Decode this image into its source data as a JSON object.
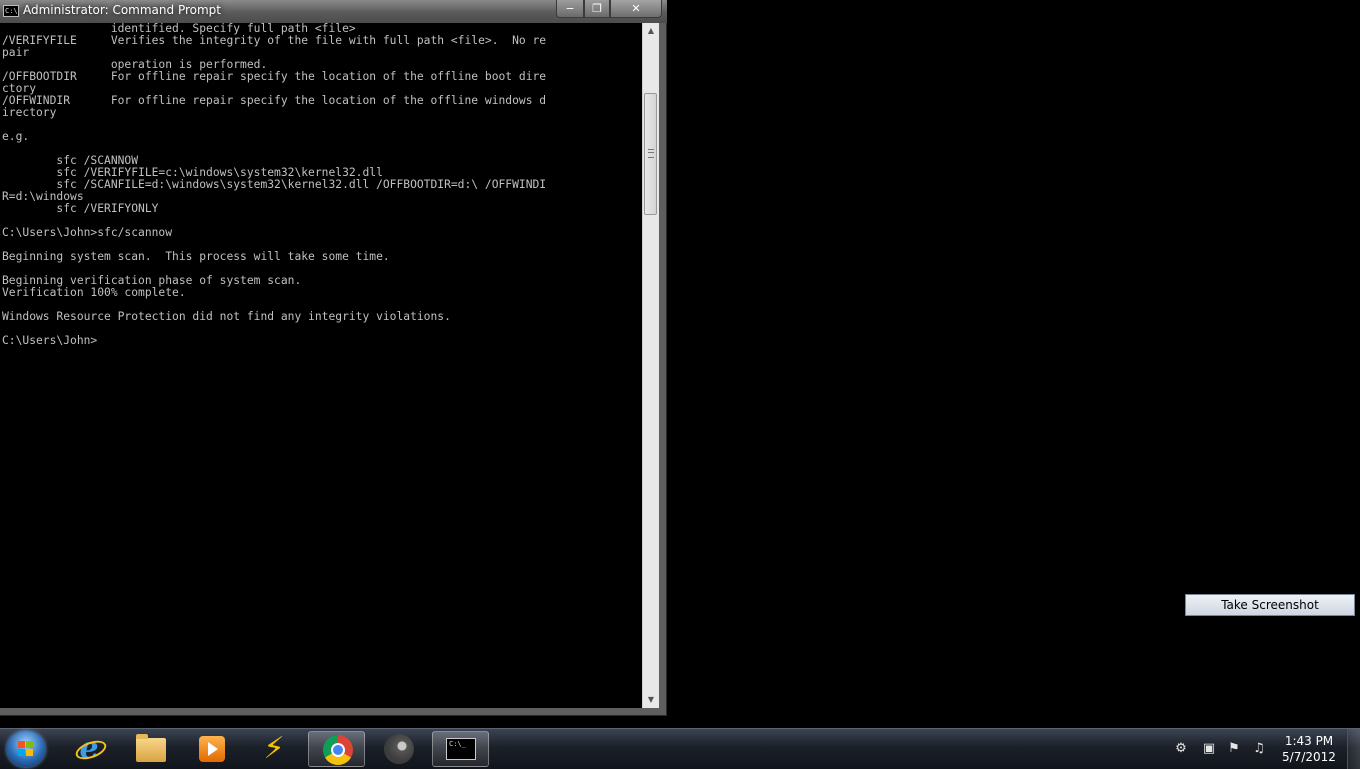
{
  "window": {
    "title": "Administrator: Command Prompt",
    "icon_label": "C:\\",
    "minimize_glyph": "−",
    "maximize_glyph": "❐",
    "close_glyph": "✕",
    "console_lines": [
      "                identified. Specify full path <file>",
      "/VERIFYFILE     Verifies the integrity of the file with full path <file>.  No re",
      "pair",
      "                operation is performed.",
      "/OFFBOOTDIR     For offline repair specify the location of the offline boot dire",
      "ctory",
      "/OFFWINDIR      For offline repair specify the location of the offline windows d",
      "irectory",
      "",
      "e.g.",
      "",
      "        sfc /SCANNOW",
      "        sfc /VERIFYFILE=c:\\windows\\system32\\kernel32.dll",
      "        sfc /SCANFILE=d:\\windows\\system32\\kernel32.dll /OFFBOOTDIR=d:\\ /OFFWINDI",
      "R=d:\\windows",
      "        sfc /VERIFYONLY",
      "",
      "C:\\Users\\John>sfc/scannow",
      "",
      "Beginning system scan.  This process will take some time.",
      "",
      "Beginning verification phase of system scan.",
      "Verification 100% complete.",
      "",
      "Windows Resource Protection did not find any integrity violations.",
      "",
      "C:\\Users\\John>"
    ]
  },
  "popup": {
    "take_screenshot_label": "Take Screenshot"
  },
  "taskbar": {
    "pinned": [
      {
        "name": "internet-explorer",
        "icon": "e"
      },
      {
        "name": "windows-explorer",
        "icon": "folder-icon"
      },
      {
        "name": "windows-media-player",
        "icon": "play-icon"
      },
      {
        "name": "winamp",
        "icon": "⚡"
      },
      {
        "name": "google-chrome",
        "icon": "chrome-icon"
      },
      {
        "name": "steam",
        "icon": "steam-icon"
      },
      {
        "name": "command-prompt",
        "icon": "C:\\_"
      }
    ],
    "tray": {
      "icons": [
        "action-center-icon",
        "network-icon",
        "flag-icon",
        "volume-icon"
      ],
      "glyphs": [
        "⚙",
        "▣",
        "⚑",
        "♫"
      ]
    },
    "clock": {
      "time": "1:43 PM",
      "date": "5/7/2012"
    }
  }
}
